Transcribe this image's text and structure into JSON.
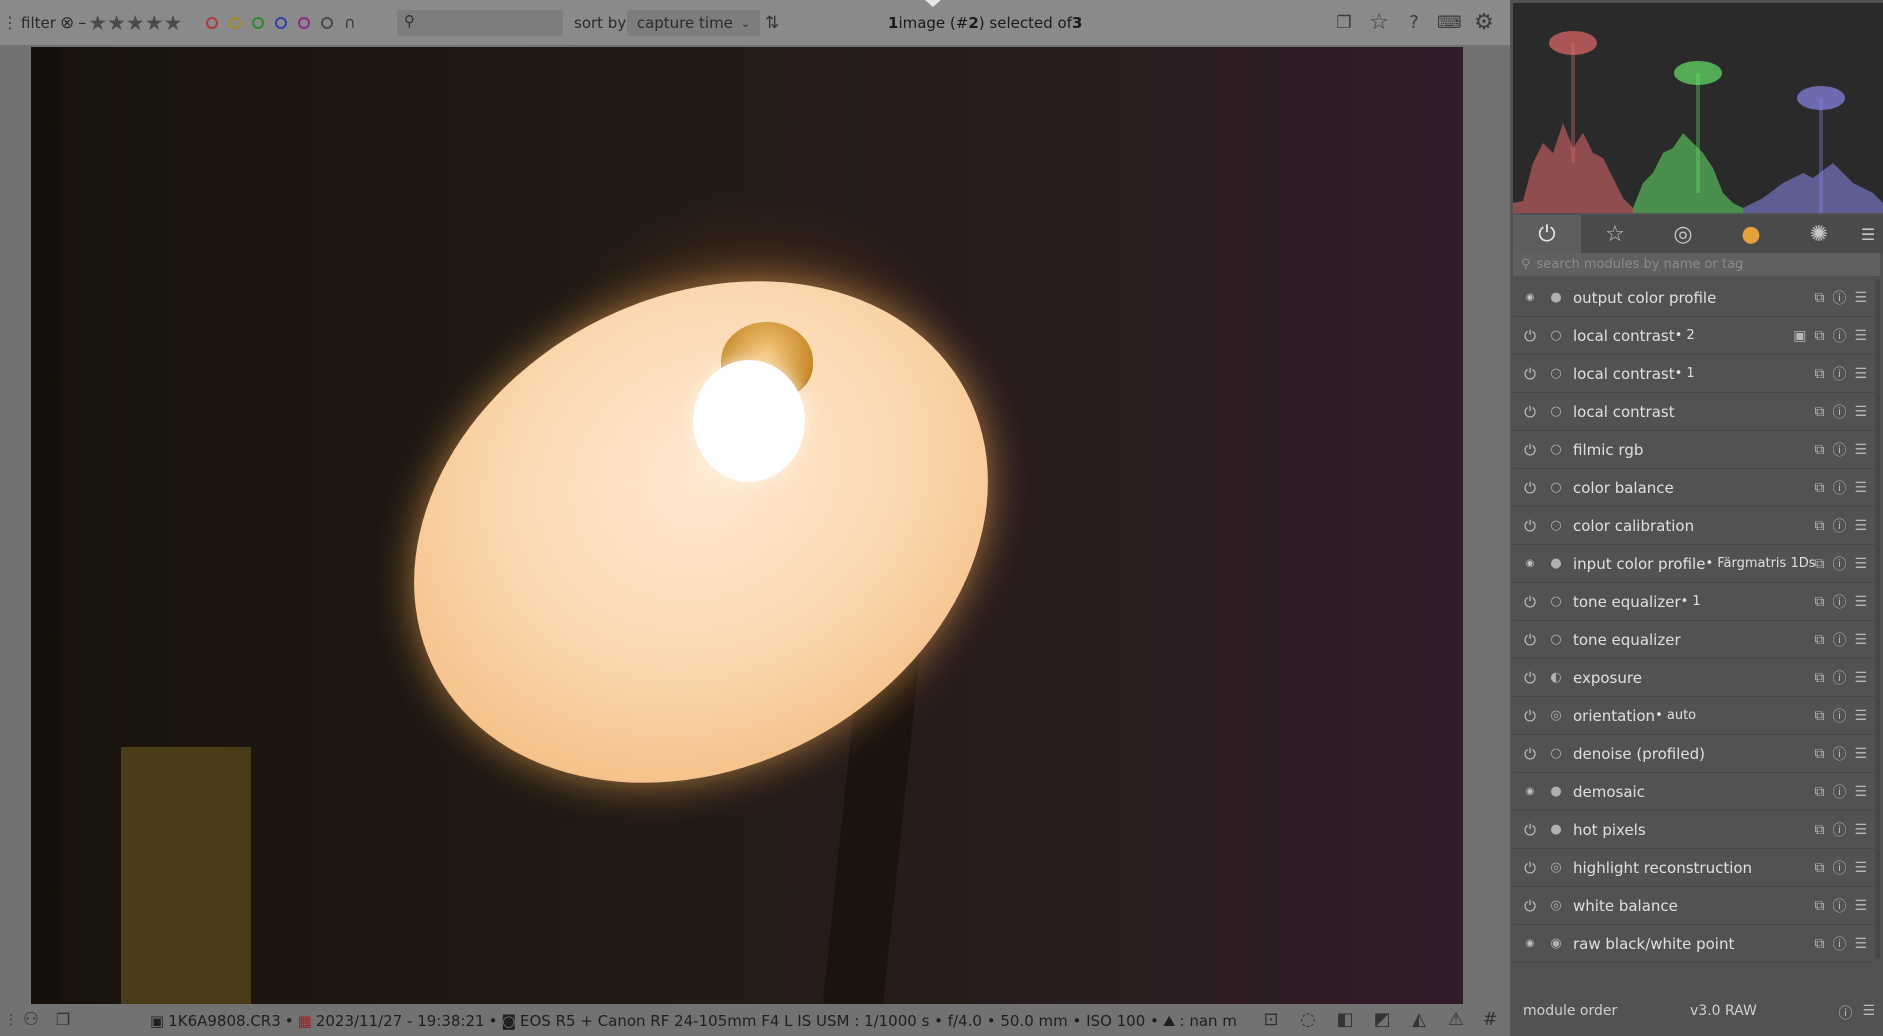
{
  "topbar": {
    "filter_label": "filter",
    "sort_label": "sort by",
    "sort_value": "capture time",
    "selection": {
      "count": "1",
      "prefix": " image (#",
      "num": "2",
      "mid": ") selected of ",
      "total": "3"
    }
  },
  "colors": {
    "red": "#b03a3a",
    "yellow": "#a38a20",
    "green": "#2c8a2c",
    "blue": "#3040a8",
    "magenta": "#8a2a8a",
    "gray": "#4a4a4a"
  },
  "histogram": {
    "series": [
      {
        "name": "red",
        "color": "#e26a6a",
        "peaks": [
          [
            0,
            200
          ],
          [
            10,
            198
          ],
          [
            20,
            160
          ],
          [
            30,
            140
          ],
          [
            40,
            150
          ],
          [
            50,
            120
          ],
          [
            60,
            145
          ],
          [
            70,
            130
          ],
          [
            80,
            150
          ],
          [
            90,
            155
          ],
          [
            100,
            175
          ],
          [
            110,
            195
          ],
          [
            120,
            205
          ]
        ]
      },
      {
        "name": "green",
        "color": "#66e26a",
        "peaks": [
          [
            120,
            205
          ],
          [
            130,
            180
          ],
          [
            140,
            170
          ],
          [
            150,
            150
          ],
          [
            160,
            145
          ],
          [
            170,
            130
          ],
          [
            180,
            140
          ],
          [
            190,
            150
          ],
          [
            200,
            165
          ],
          [
            210,
            190
          ],
          [
            220,
            200
          ],
          [
            230,
            205
          ]
        ]
      },
      {
        "name": "blue",
        "color": "#8a88e8",
        "peaks": [
          [
            230,
            205
          ],
          [
            250,
            195
          ],
          [
            270,
            180
          ],
          [
            290,
            170
          ],
          [
            300,
            175
          ],
          [
            320,
            160
          ],
          [
            340,
            180
          ],
          [
            360,
            190
          ],
          [
            370,
            200
          ]
        ]
      }
    ]
  },
  "module_groups": [
    {
      "icon": "power-icon",
      "glyph": "⏻",
      "active": true
    },
    {
      "icon": "star-icon",
      "glyph": "☆",
      "active": false
    },
    {
      "icon": "aperture-icon",
      "glyph": "◎",
      "active": false
    },
    {
      "icon": "color-wheel-icon",
      "glyph": "●",
      "active": false
    },
    {
      "icon": "effects-icon",
      "glyph": "✺",
      "active": false
    }
  ],
  "module_search": {
    "placeholder": "search modules by name or tag"
  },
  "modules": [
    {
      "name": "output color profile",
      "instance": "",
      "power": "dot",
      "icon": "●",
      "mask": false
    },
    {
      "name": "local contrast",
      "instance": " • 2",
      "power": "on",
      "icon": "○",
      "mask": true
    },
    {
      "name": "local contrast",
      "instance": " • 1",
      "power": "on",
      "icon": "○",
      "mask": false
    },
    {
      "name": "local contrast",
      "instance": "",
      "power": "on",
      "icon": "○",
      "mask": false
    },
    {
      "name": "filmic rgb",
      "instance": "",
      "power": "on",
      "icon": "○",
      "mask": false
    },
    {
      "name": "color balance",
      "instance": "",
      "power": "on",
      "icon": "○",
      "mask": false
    },
    {
      "name": "color calibration",
      "instance": "",
      "power": "on",
      "icon": "○",
      "mask": false
    },
    {
      "name": "input color profile",
      "instance": " • Färgmatris 1Ds",
      "power": "dot",
      "icon": "●",
      "mask": false
    },
    {
      "name": "tone equalizer",
      "instance": " • 1",
      "power": "on",
      "icon": "○",
      "mask": false
    },
    {
      "name": "tone equalizer",
      "instance": "",
      "power": "on",
      "icon": "○",
      "mask": false
    },
    {
      "name": "exposure",
      "instance": "",
      "power": "on",
      "icon": "◐",
      "mask": false
    },
    {
      "name": "orientation",
      "instance": " • auto",
      "power": "on",
      "icon": "◎",
      "mask": false
    },
    {
      "name": "denoise (profiled)",
      "instance": "",
      "power": "on",
      "icon": "○",
      "mask": false
    },
    {
      "name": "demosaic",
      "instance": "",
      "power": "dot",
      "icon": "●",
      "mask": false
    },
    {
      "name": "hot pixels",
      "instance": "",
      "power": "on",
      "icon": "●",
      "mask": false
    },
    {
      "name": "highlight reconstruction",
      "instance": "",
      "power": "on",
      "icon": "◎",
      "mask": false
    },
    {
      "name": "white balance",
      "instance": "",
      "power": "on",
      "icon": "◎",
      "mask": false
    },
    {
      "name": "raw black/white point",
      "instance": "",
      "power": "dot",
      "icon": "◉",
      "mask": false
    }
  ],
  "footer_panel": {
    "module_order_label": "module order",
    "module_order_value": "v3.0 RAW"
  },
  "bottombar": {
    "filename": "1K6A9808.CR3",
    "datetime": "2023/11/27 - 19:38:21",
    "camera": "EOS R5 + Canon RF 24-105mm F4 L IS USM : 1/1000 s • f/4.0 • 50.0 mm • ISO 100 •",
    "altitude": ": nan m"
  }
}
